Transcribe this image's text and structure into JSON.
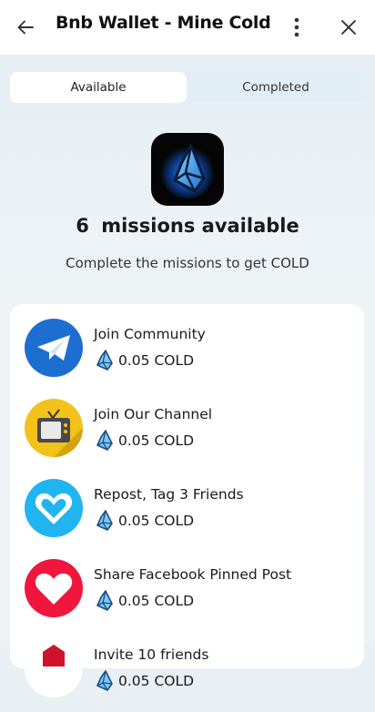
{
  "header": {
    "title": "Bnb Wallet - Mine Cold"
  },
  "tabs": [
    {
      "label": "Available",
      "active": true
    },
    {
      "label": "Completed",
      "active": false
    }
  ],
  "hero": {
    "count": "6",
    "count_label": "missions available",
    "subtitle": "Complete the missions to get COLD"
  },
  "missions": [
    {
      "title": "Join Community",
      "reward": "0.05 COLD",
      "icon": "telegram-icon",
      "color": "#1d6ed1"
    },
    {
      "title": "Join Our Channel",
      "reward": "0.05 COLD",
      "icon": "tv-icon",
      "color": "#f2c21b"
    },
    {
      "title": "Repost, Tag 3 Friends",
      "reward": "0.05 COLD",
      "icon": "heart-icon",
      "color": "#20b4f0"
    },
    {
      "title": "Share Facebook Pinned Post",
      "reward": "0.05 COLD",
      "icon": "heart-icon",
      "color": "#f0163d"
    },
    {
      "title": "Invite 10 friends",
      "reward": "0.05 COLD",
      "icon": "gift-icon",
      "color": "#d0122d"
    }
  ]
}
